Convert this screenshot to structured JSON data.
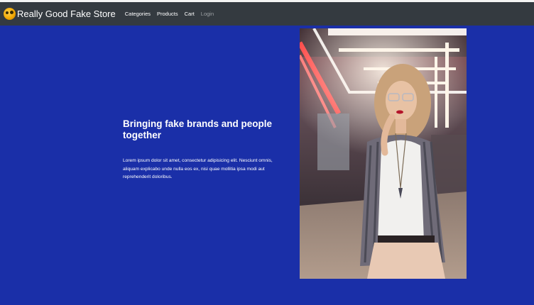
{
  "brand": {
    "name": "Really Good Fake Store",
    "logo_icon": "smiley-emoji-icon"
  },
  "nav": {
    "items": [
      {
        "label": "Categories"
      },
      {
        "label": "Products"
      },
      {
        "label": "Cart"
      },
      {
        "label": "Login"
      }
    ]
  },
  "hero": {
    "title": "Bringing fake brands and people together",
    "text": "Lorem ipsum dolor sit amet, consectetur adipisicing elit. Nesciunt omnis, aliquam explicabo unde nulla eos ex, nisi quae mollitia ipsa modi aut reprehenderit doloribus.",
    "image_subject": "woman-in-neon-lit-arcade-photo"
  },
  "colors": {
    "navbar": "#343a40",
    "hero_background": "#1a2fa8",
    "text": "#ffffff",
    "muted_link": "#9ca0a4"
  }
}
